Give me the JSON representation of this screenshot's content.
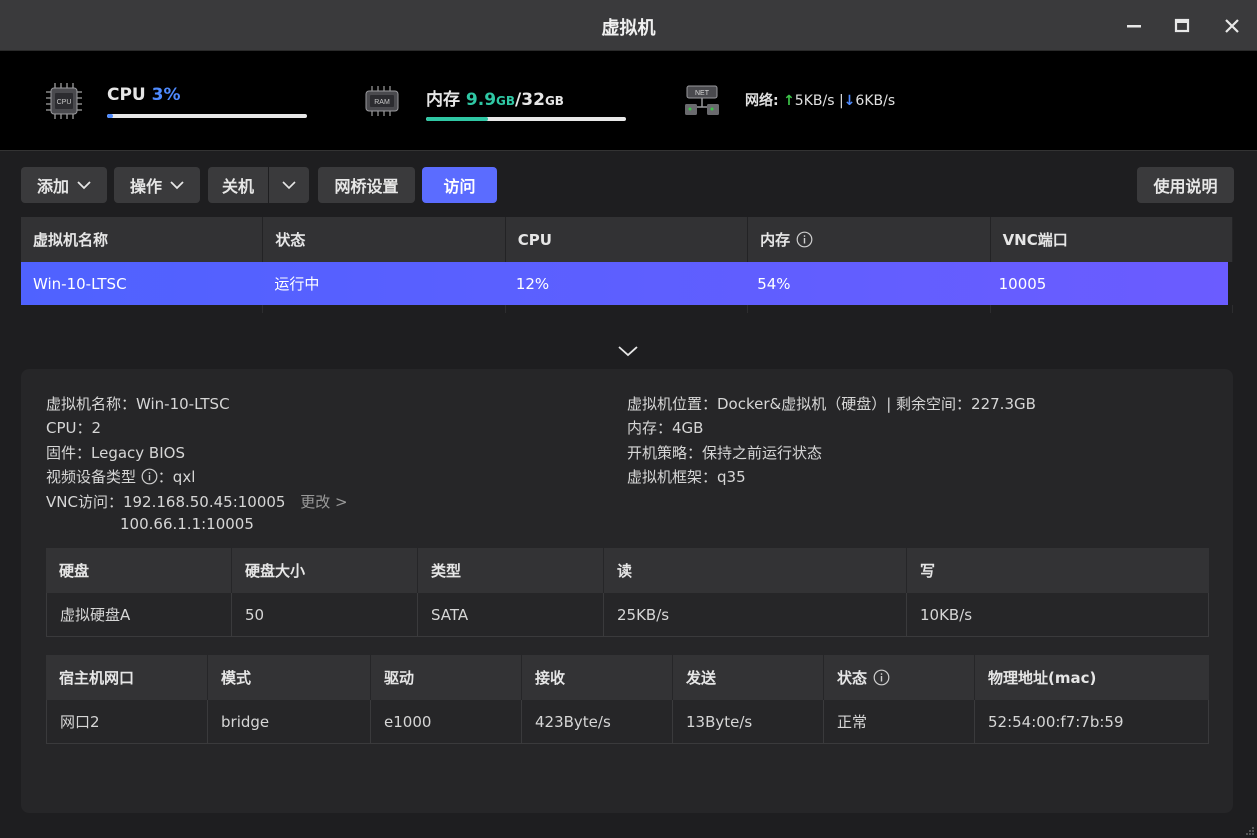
{
  "window": {
    "title": "虚拟机"
  },
  "stats": {
    "cpu": {
      "label": "CPU",
      "value": "3%",
      "usage": 0.03
    },
    "memory": {
      "label": "内存",
      "used": "9.9",
      "used_unit": "GB",
      "separator": "/",
      "total": "32",
      "total_unit": "GB",
      "usage": 0.31
    },
    "network": {
      "label": "网络:",
      "up_arrow": "↑",
      "up": "5KB/s",
      "divider": "|",
      "down_arrow": "↓",
      "down": "6KB/s"
    },
    "icons": {
      "cpu_text": "CPU",
      "ram_text": "RAM",
      "net_text": "NET"
    }
  },
  "toolbar": {
    "add": "添加",
    "operate": "操作",
    "shutdown": "关机",
    "bridge": "网桥设置",
    "visit": "访问",
    "help": "使用说明"
  },
  "vm_table": {
    "headers": [
      "虚拟机名称",
      "状态",
      "CPU",
      "内存",
      "VNC端口"
    ],
    "rows": [
      {
        "name": "Win-10-LTSC",
        "status": "运行中",
        "cpu": "12%",
        "memory": "54%",
        "vnc": "10005"
      }
    ]
  },
  "detail": {
    "name": "虚拟机名称：Win-10-LTSC",
    "cpu": "CPU：2",
    "firmware": "固件：Legacy BIOS",
    "video_label": "视频设备类型",
    "video_value": "：qxl",
    "vnc_label": "VNC访问：",
    "vnc_addr1": "192.168.50.45:10005",
    "vnc_change": "更改 >",
    "vnc_addr2": "100.66.1.1:10005",
    "location": "虚拟机位置：Docker&虚拟机（硬盘）| 剩余空间：227.3GB",
    "memory": "内存：4GB",
    "boot_policy": "开机策略：保持之前运行状态",
    "arch": "虚拟机框架：q35"
  },
  "disk_table": {
    "headers": [
      "硬盘",
      "硬盘大小",
      "类型",
      "读",
      "写"
    ],
    "rows": [
      [
        "虚拟硬盘A",
        "50",
        "SATA",
        "25KB/s",
        "10KB/s"
      ]
    ]
  },
  "net_table": {
    "headers": [
      "宿主机网口",
      "模式",
      "驱动",
      "接收",
      "发送",
      "状态",
      "物理地址(mac)"
    ],
    "rows": [
      [
        "网口2",
        "bridge",
        "e1000",
        "423Byte/s",
        "13Byte/s",
        "正常",
        "52:54:00:f7:7b:59"
      ]
    ]
  },
  "colors": {
    "accent": "#5b6cff",
    "cpu_bar": "#4f8bff",
    "ram_bar": "#2fc7a4",
    "up": "#3ec54a",
    "down": "#4f8bff"
  }
}
